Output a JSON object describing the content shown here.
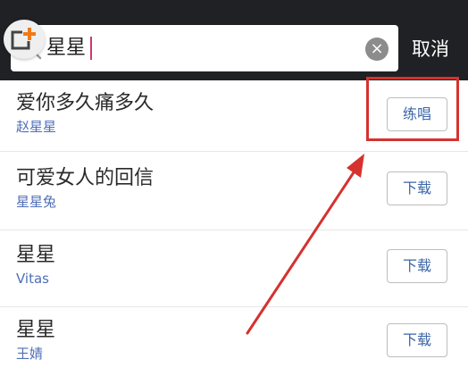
{
  "search": {
    "query": "星星",
    "cancel_label": "取消",
    "clear_symbol": "×"
  },
  "results": [
    {
      "title": "爱你多久痛多久",
      "artist": "赵星星",
      "action": "练唱"
    },
    {
      "title": "可爱女人的回信",
      "artist": "星星兔",
      "action": "下载"
    },
    {
      "title": "星星",
      "artist": "Vitas",
      "action": "下载"
    },
    {
      "title": "星星",
      "artist": "王婧",
      "action": "下载"
    }
  ],
  "colors": {
    "header_bg": "#1f2124",
    "artist_text": "#4f6fb6",
    "button_text": "#3c66a8",
    "annotation_red": "#d5322f",
    "caret": "#d2386b"
  },
  "icons": {
    "add": "add-badge-icon",
    "search": "search-icon",
    "clear": "clear-icon"
  }
}
